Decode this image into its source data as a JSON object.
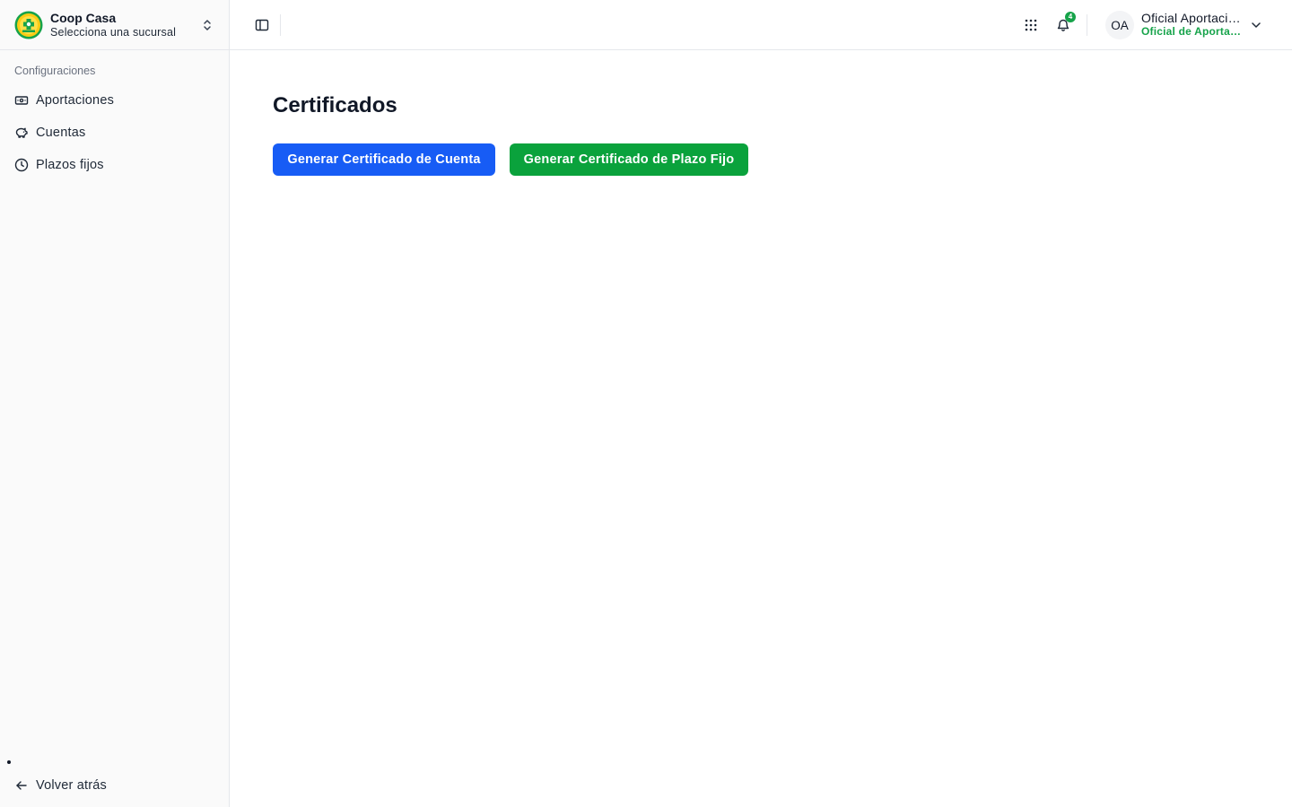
{
  "sidebar": {
    "org": {
      "name": "Coop Casa",
      "subtitle": "Selecciona una sucursal",
      "logo_text": "COOP CASA"
    },
    "section_label": "Configuraciones",
    "items": [
      {
        "label": "Aportaciones",
        "icon": "banknote-icon"
      },
      {
        "label": "Cuentas",
        "icon": "piggy-bank-icon"
      },
      {
        "label": "Plazos fijos",
        "icon": "clock-icon"
      }
    ],
    "back_label": "Volver atrás"
  },
  "topbar": {
    "notification_count": "4",
    "user": {
      "initials": "OA",
      "name": "Oficial Aportaciones",
      "role": "Oficial de Aportaciones"
    }
  },
  "main": {
    "title": "Certificados",
    "buttons": {
      "cuenta": "Generar Certificado de Cuenta",
      "plazo_fijo": "Generar Certificado de Plazo Fijo"
    }
  },
  "colors": {
    "primary_blue": "#175cf5",
    "primary_green": "#0aa23c",
    "role_green": "#16a34a",
    "sidebar_bg": "#fafafa"
  }
}
